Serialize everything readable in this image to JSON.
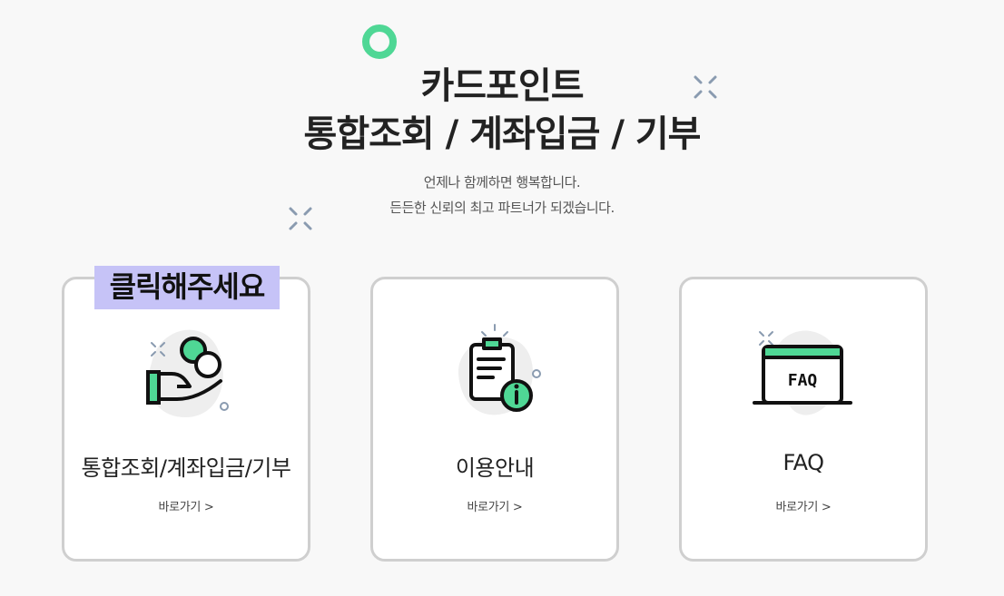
{
  "header": {
    "title_line1": "카드포인트",
    "title_line2": "통합조회 / 계좌입금 / 기부",
    "subtitle_line1": "언제나 함께하면 행복합니다.",
    "subtitle_line2": "든든한 신뢰의 최고 파트너가 되겠습니다."
  },
  "hint": {
    "label": "클릭해주세요"
  },
  "cards": [
    {
      "title": "통합조회/계좌입금/기부",
      "link": "바로가기 >",
      "icon": "hand-coin-icon"
    },
    {
      "title": "이용안내",
      "link": "바로가기 >",
      "icon": "clipboard-info-icon"
    },
    {
      "title": "FAQ",
      "link": "바로가기 >",
      "icon": "faq-window-icon"
    }
  ],
  "colors": {
    "accent": "#4fd795",
    "border": "#cfcfcf",
    "blob": "#eeeeee",
    "hint_bg": "#c6c3f7"
  }
}
